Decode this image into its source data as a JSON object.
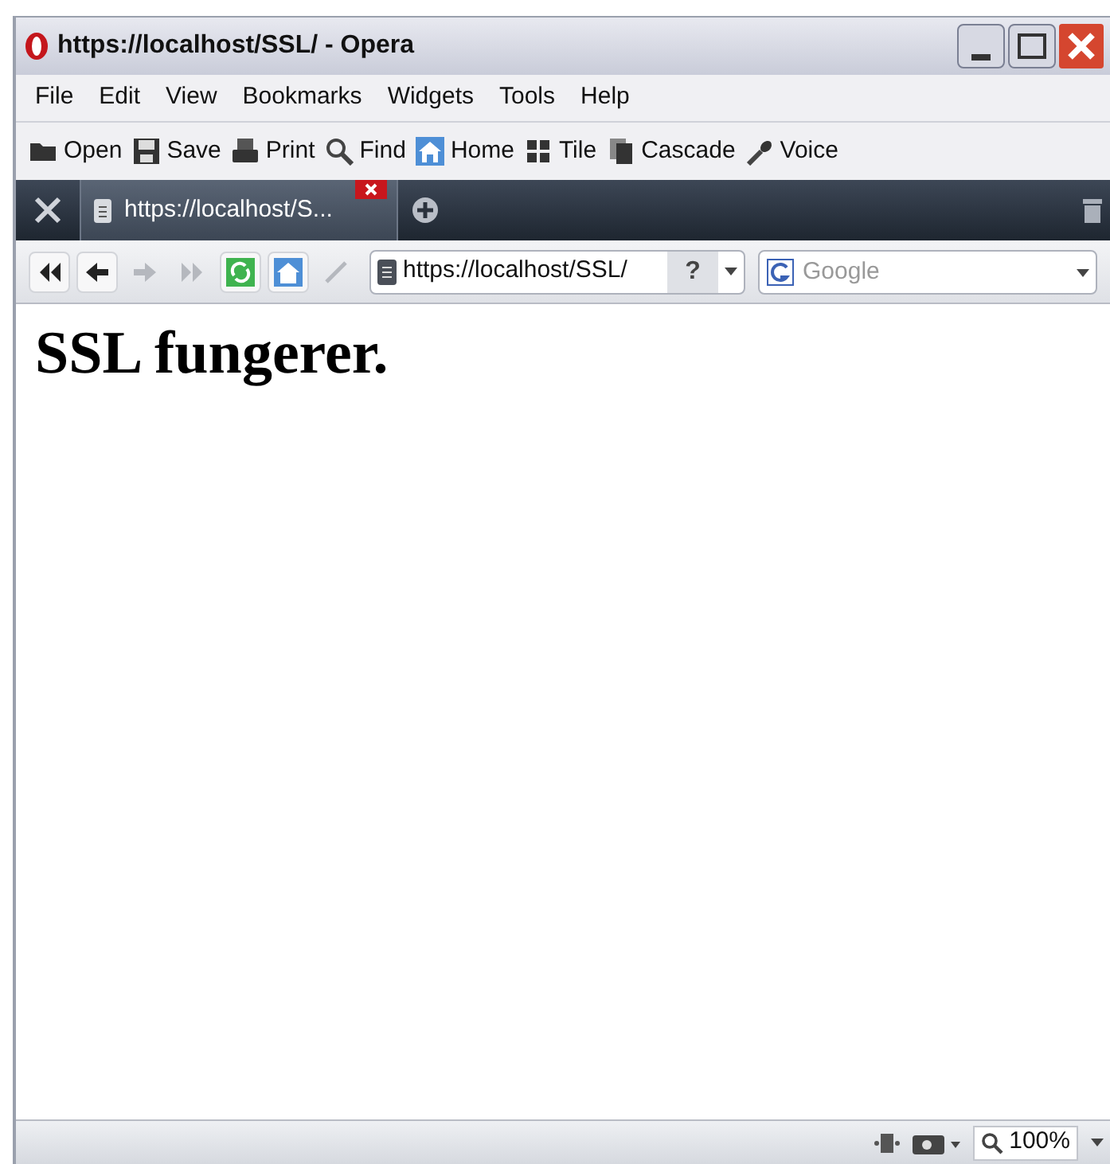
{
  "window": {
    "title": "https://localhost/SSL/ - Opera"
  },
  "menu": [
    "File",
    "Edit",
    "View",
    "Bookmarks",
    "Widgets",
    "Tools",
    "Help"
  ],
  "toolbar": [
    {
      "kind": "open",
      "label": "Open"
    },
    {
      "kind": "save",
      "label": "Save"
    },
    {
      "kind": "print",
      "label": "Print"
    },
    {
      "kind": "find",
      "label": "Find"
    },
    {
      "kind": "home",
      "label": "Home"
    },
    {
      "kind": "tile",
      "label": "Tile"
    },
    {
      "kind": "cascade",
      "label": "Cascade"
    },
    {
      "kind": "voice",
      "label": "Voice"
    }
  ],
  "tabs": [
    {
      "label": "https://localhost/S...",
      "selected": true
    }
  ],
  "nav_buttons": [
    {
      "kind": "rewind",
      "disabled": false
    },
    {
      "kind": "back",
      "disabled": false
    },
    {
      "kind": "forward",
      "disabled": true
    },
    {
      "kind": "fastforward",
      "disabled": true
    },
    {
      "kind": "reload",
      "disabled": false
    },
    {
      "kind": "home",
      "disabled": false
    },
    {
      "kind": "edit",
      "disabled": true
    }
  ],
  "address": {
    "value": "https://localhost/SSL/",
    "info_button": "?"
  },
  "search": {
    "placeholder": "Google"
  },
  "content": {
    "heading": "SSL fungerer."
  },
  "status_bar": {
    "zoom": "100%"
  }
}
